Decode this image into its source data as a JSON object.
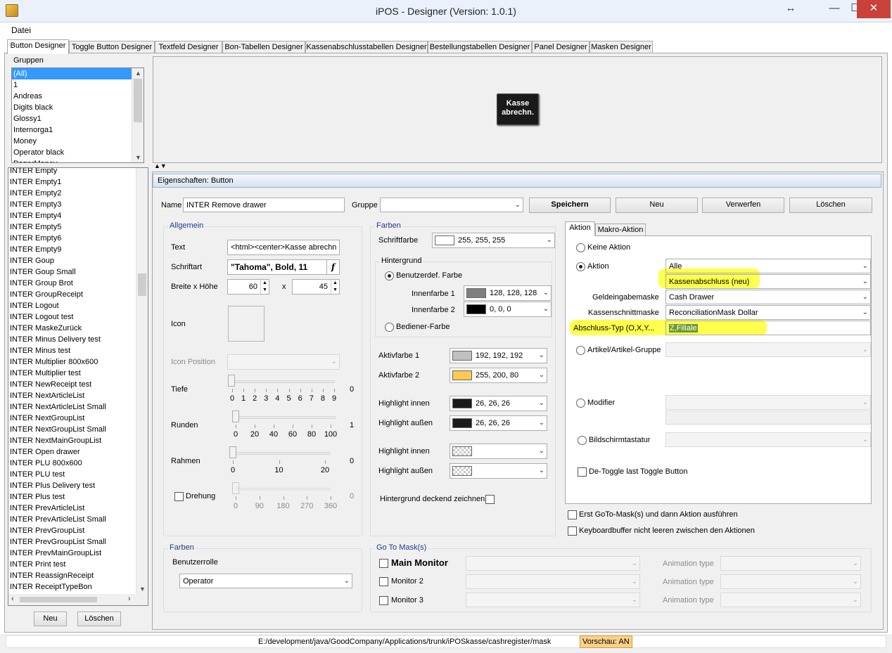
{
  "window": {
    "title": "iPOS - Designer  (Version: 1.0.1)",
    "resize_glyph": "↔",
    "minimize_glyph": "—",
    "maximize_glyph": "☐",
    "close_glyph": "✕"
  },
  "menu": {
    "file": "Datei"
  },
  "tabs": [
    "Button Designer",
    "Toggle Button Designer",
    "Textfeld Designer",
    "Bon-Tabellen Designer",
    "Kassenabschlusstabellen Designer",
    "Bestellungstabellen Designer",
    "Panel Designer",
    "Masken Designer"
  ],
  "groups": {
    "title": "Gruppen",
    "items": [
      "(All)",
      "1",
      "Andreas",
      "Digits black",
      "Glossy1",
      "Internorga1",
      "Money",
      "Operator black",
      "PagerMoney"
    ],
    "selected_index": 0
  },
  "buttons_list": {
    "items": [
      "INTER Empty",
      "INTER Empty1",
      "INTER Empty2",
      "INTER Empty3",
      "INTER Empty4",
      "INTER Empty5",
      "INTER Empty6",
      "INTER Empty9",
      "INTER Goup",
      "INTER Goup Small",
      "INTER Group Brot",
      "INTER GroupReceipt",
      "INTER Logout",
      "INTER Logout test",
      "INTER MaskeZurück",
      "INTER Minus Delivery test",
      "INTER Minus test",
      "INTER Multiplier 800x600",
      "INTER Multiplier test",
      "INTER NewReceipt test",
      "INTER NextArticleList",
      "INTER NextArticleList Small",
      "INTER NextGroupList",
      "INTER NextGroupList Small",
      "INTER NextMainGroupList",
      "INTER Open drawer",
      "INTER PLU 800x600",
      "INTER PLU test",
      "INTER Plus Delivery test",
      "INTER Plus test",
      "INTER PrevArticleList",
      "INTER PrevArticleList Small",
      "INTER PrevGroupList",
      "INTER PrevGroupList Small",
      "INTER PrevMainGroupList",
      "INTER Print test",
      "INTER ReassignReceipt",
      "INTER ReceiptTypeBon"
    ],
    "new_label": "Neu",
    "delete_label": "Löschen"
  },
  "preview": {
    "button_text_line1": "Kasse",
    "button_text_line2": "abrechn.",
    "collapse_glyph": "▲▼"
  },
  "properties": {
    "header": "Eigenschaften: Button",
    "name_label": "Name",
    "name_value": "INTER Remove drawer",
    "gruppe_label": "Gruppe",
    "gruppe_value": "",
    "save_label": "Speichern",
    "new_label": "Neu",
    "discard_label": "Verwerfen",
    "delete_label": "Löschen"
  },
  "allgemein": {
    "title": "Allgemein",
    "text_label": "Text",
    "text_value": "<html><center>Kasse abrechn",
    "font_label": "Schriftart",
    "font_value": "\"Tahoma\", Bold, 11",
    "font_btn_glyph": "f",
    "size_label": "Breite x Höhe",
    "width_value": "60",
    "x_label": "x",
    "height_value": "45",
    "icon_label": "Icon",
    "icon_position_label": "Icon Position",
    "tiefe_label": "Tiefe",
    "tiefe_value": "0",
    "tiefe_ticks": [
      "0",
      "1",
      "2",
      "3",
      "4",
      "5",
      "6",
      "7",
      "8",
      "9"
    ],
    "runden_label": "Runden",
    "runden_value": "1",
    "runden_ticks": [
      "0",
      "20",
      "40",
      "60",
      "80",
      "100"
    ],
    "rahmen_label": "Rahmen",
    "rahmen_value": "0",
    "rahmen_ticks": [
      "0",
      "10",
      "20"
    ],
    "drehung_label": "Drehung",
    "drehung_value": "0",
    "drehung_ticks": [
      "0",
      "90",
      "180",
      "270",
      "360"
    ]
  },
  "farben": {
    "title": "Farben",
    "schriftfarbe_label": "Schriftfarbe",
    "schriftfarbe_value": "255, 255, 255",
    "schriftfarbe_hex": "#ffffff",
    "hintergrund_title": "Hintergrund",
    "benutzerdef_label": "Benutzerdef. Farbe",
    "innenfarbe1_label": "Innenfarbe 1",
    "innenfarbe1_value": "128, 128, 128",
    "innenfarbe1_hex": "#808080",
    "innenfarbe2_label": "Innenfarbe 2",
    "innenfarbe2_value": "0, 0, 0",
    "innenfarbe2_hex": "#000000",
    "bediener_label": "Bediener-Farbe",
    "aktivfarbe1_label": "Aktivfarbe 1",
    "aktivfarbe1_value": "192, 192, 192",
    "aktivfarbe1_hex": "#c0c0c0",
    "aktivfarbe2_label": "Aktivfarbe 2",
    "aktivfarbe2_value": "255, 200, 80",
    "aktivfarbe2_hex": "#ffc850",
    "highlight_innen_label": "Highlight innen",
    "highlight_innen_value": "26, 26, 26",
    "highlight_innen_hex": "#1a1a1a",
    "highlight_aussen_label": "Highlight außen",
    "highlight_aussen_value": "26, 26, 26",
    "highlight_aussen_hex": "#1a1a1a",
    "highlight_innen2_label": "Highlight innen",
    "highlight_aussen2_label": "Highlight außen",
    "deckend_label": "Hintergrund deckend zeichnen"
  },
  "aktion": {
    "tab_aktion": "Aktion",
    "tab_makro": "Makro-Aktion",
    "keine_aktion": "Keine Aktion",
    "aktion_label": "Aktion",
    "aktion_category": "Alle",
    "aktion_value": "Kassenabschluss (neu)",
    "geldeingabe_label": "Geldeingabemaske",
    "geldeingabe_value": "Cash Drawer",
    "kassenschnitt_label": "Kassenschnittmaske",
    "kassenschnitt_value": "ReconciliationMask Dollar",
    "abschluss_label": "Abschluss-Typ (O,X,Y...",
    "abschluss_value": "Z,Filiale",
    "artikel_label": "Artikel/Artikel-Gruppe",
    "modifier_label": "Modifier",
    "bildschirm_label": "Bildschirmtastatur",
    "detoggle_label": "De-Toggle last Toggle Button",
    "erst_goto_label": "Erst GoTo-Mask(s) und dann Aktion ausführen",
    "keyboardbuffer_label": "Keyboardbuffer nicht leeren zwischen den Aktionen"
  },
  "farben2": {
    "title": "Farben",
    "benutzerrolle_label": "Benutzerrolle",
    "benutzerrolle_value": "Operator"
  },
  "goto": {
    "title": "Go To Mask(s)",
    "main_monitor": "Main Monitor",
    "monitor2": "Monitor 2",
    "monitor3": "Monitor 3",
    "animation_label": "Animation type"
  },
  "status": {
    "path": "E:/development/java/GoodCompany/Applications/trunk/iPOSkasse/cashregister/mask",
    "preview": "Vorschau: AN"
  },
  "colors": {
    "accent_selection": "#3399ff",
    "highlight_marker": "#ffff3a",
    "preview_badge": "#fbd18a"
  }
}
